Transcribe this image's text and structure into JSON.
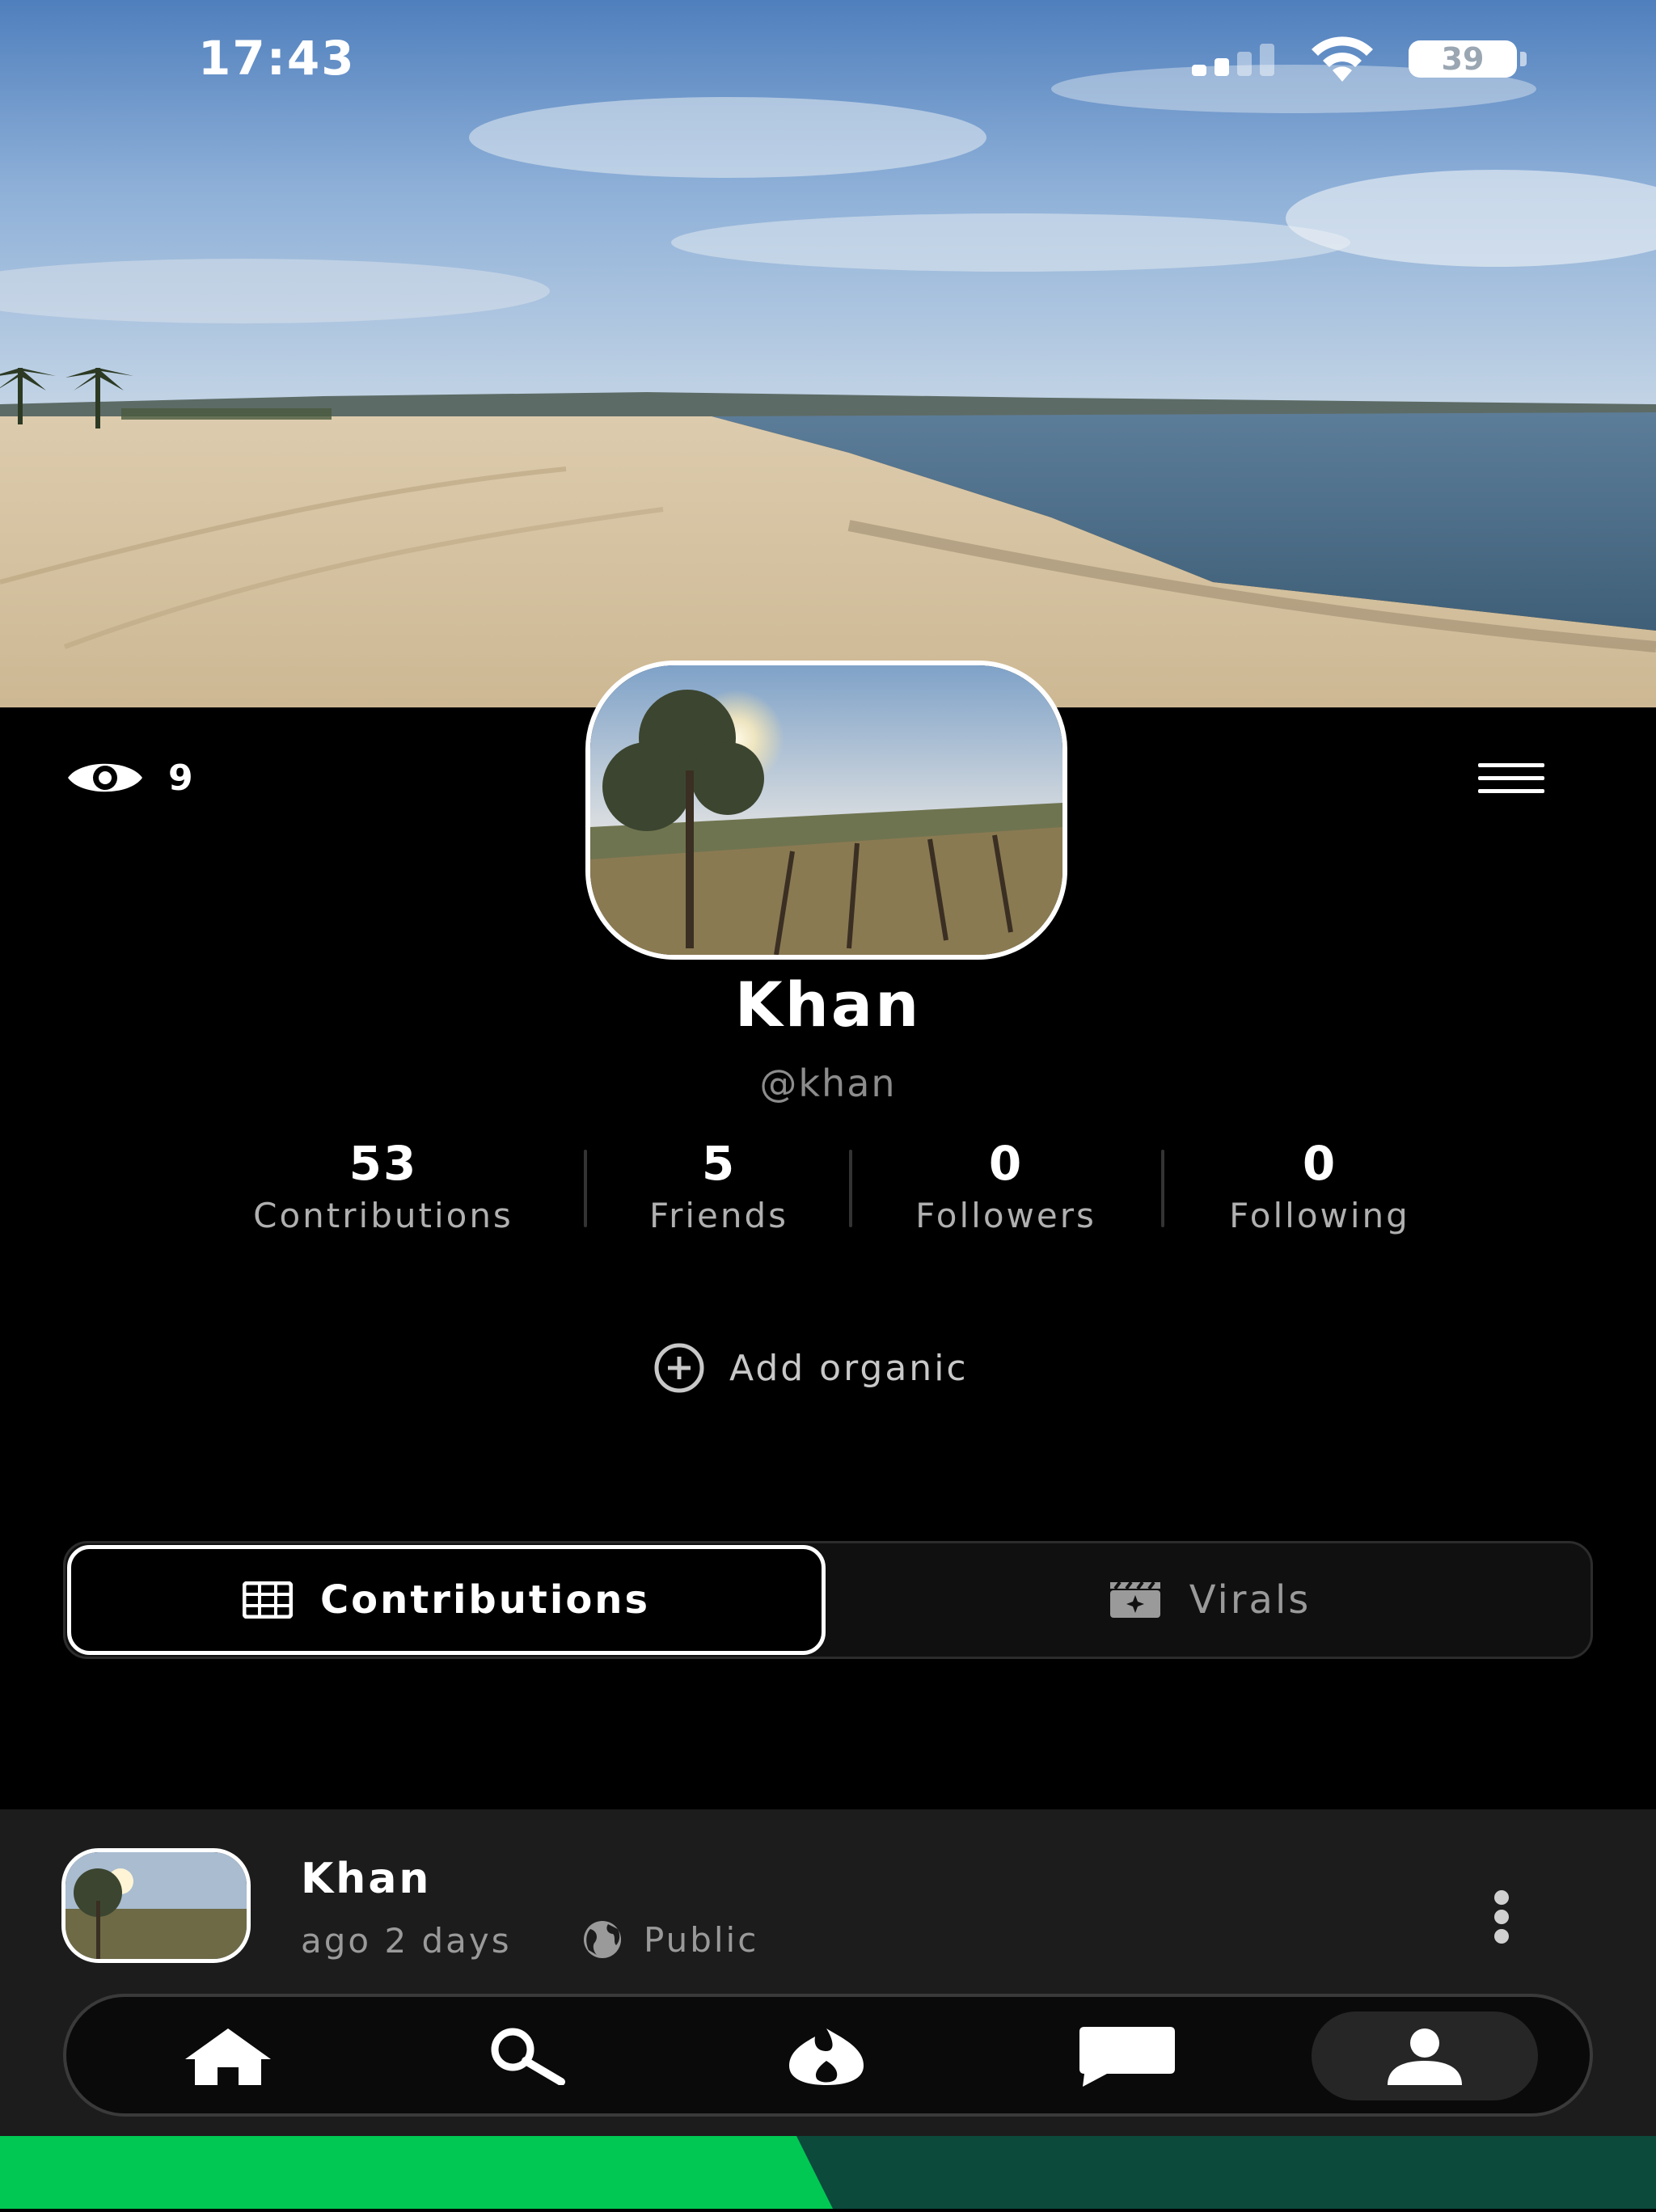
{
  "status_bar": {
    "time": "17:43",
    "battery_level": "39",
    "signal_bars_filled": 2,
    "signal_bars_total": 4
  },
  "profile": {
    "views_count": "9",
    "display_name": "Khan",
    "handle": "@khan",
    "stats": [
      {
        "value": "53",
        "label": "Contributions"
      },
      {
        "value": "5",
        "label": "Friends"
      },
      {
        "value": "0",
        "label": "Followers"
      },
      {
        "value": "0",
        "label": "Following"
      }
    ],
    "add_organic_label": "Add organic"
  },
  "tabs": {
    "contributions": {
      "label": "Contributions",
      "icon": "grid-icon",
      "active": true
    },
    "virals": {
      "label": "Virals",
      "icon": "clapperboard-sparkle-icon",
      "active": false
    }
  },
  "post": {
    "author": "Khan",
    "time": "ago 2 days",
    "privacy": "Public",
    "privacy_icon": "globe-icon"
  },
  "bottom_nav": {
    "items": [
      {
        "name": "home",
        "icon": "home-icon"
      },
      {
        "name": "search",
        "icon": "search-icon"
      },
      {
        "name": "organic",
        "icon": "flame-leaf-icon"
      },
      {
        "name": "messages",
        "icon": "chat-bubble-icon"
      },
      {
        "name": "profile",
        "icon": "person-icon",
        "active": true
      }
    ]
  },
  "colors": {
    "background": "#000000",
    "card": "#1c1c1c",
    "muted_text": "#9a9a9a",
    "banner_green": "#00c853",
    "banner_dark_green": "#0c4a3c"
  }
}
